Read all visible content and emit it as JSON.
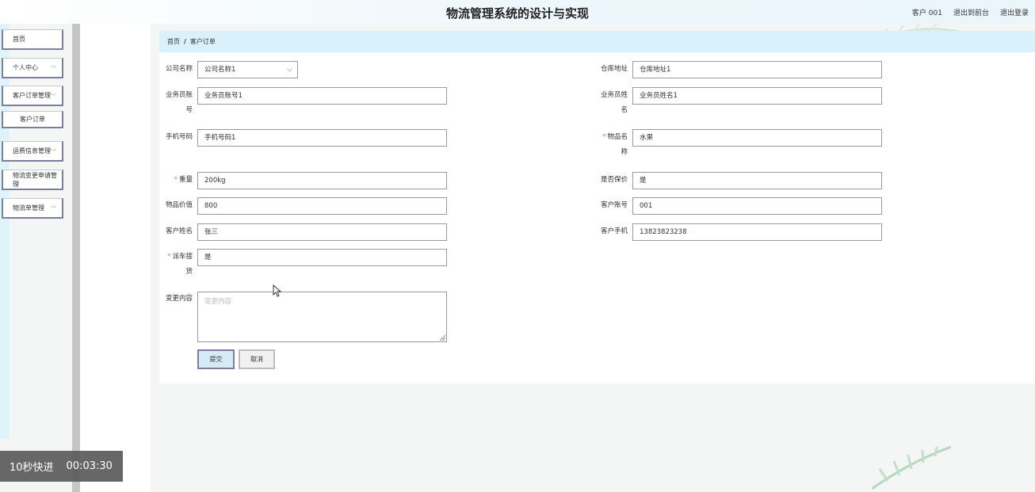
{
  "header": {
    "title": "物流管理系统的设计与实现",
    "user": "客户 001",
    "back_to_front": "退出到前台",
    "logout": "退出登录"
  },
  "sidebar": {
    "items": [
      {
        "label": "首页",
        "has_chevron": false
      },
      {
        "label": "个人中心",
        "has_chevron": true
      },
      {
        "label": "客户订单管理",
        "has_chevron": true
      },
      {
        "label": "客户订单",
        "has_chevron": false
      },
      {
        "label": "运费信息管理",
        "has_chevron": true
      },
      {
        "label": "物流变更申请管理",
        "has_chevron": false
      },
      {
        "label": "物流单管理",
        "has_chevron": true
      }
    ]
  },
  "breadcrumb": {
    "home": "首页",
    "separator": "/",
    "current": "客户订单"
  },
  "form": {
    "company_name": {
      "label": "公司名称",
      "value": "公司名称1"
    },
    "warehouse_address": {
      "label": "仓库地址",
      "value": "仓库地址1"
    },
    "salesman_account": {
      "label_line1": "业务员账",
      "label_line2": "号",
      "value": "业务员账号1"
    },
    "salesman_name": {
      "label_line1": "业务员姓",
      "label_line2": "名",
      "value": "业务员姓名1"
    },
    "phone": {
      "label": "手机号码",
      "value": "手机号码1"
    },
    "goods_name": {
      "label_line1": "物品名",
      "label_line2": "称",
      "value": "水果",
      "required": "*"
    },
    "weight": {
      "label": "重量",
      "value": "200kg",
      "required": "*"
    },
    "insured": {
      "label": "是否保价",
      "value": "是"
    },
    "goods_value": {
      "label": "物品价值",
      "value": "800"
    },
    "customer_account": {
      "label": "客户账号",
      "value": "001"
    },
    "customer_name": {
      "label": "客户姓名",
      "value": "张三"
    },
    "customer_phone": {
      "label": "客户手机",
      "value": "13823823238"
    },
    "pickup": {
      "label_line1": "派车接",
      "label_line2": "货",
      "value": "是",
      "required": "*"
    },
    "change_content": {
      "label": "变更内容",
      "placeholder": "变更内容"
    },
    "submit_label": "提交",
    "cancel_label": "取消"
  },
  "timer": {
    "speed": "10秒快进",
    "time": "00:03:30"
  },
  "colors": {
    "breadcrumb_bg": "#d9f1fb",
    "required": "#f56c6c",
    "sidebar_border": "#7b7e9c"
  }
}
